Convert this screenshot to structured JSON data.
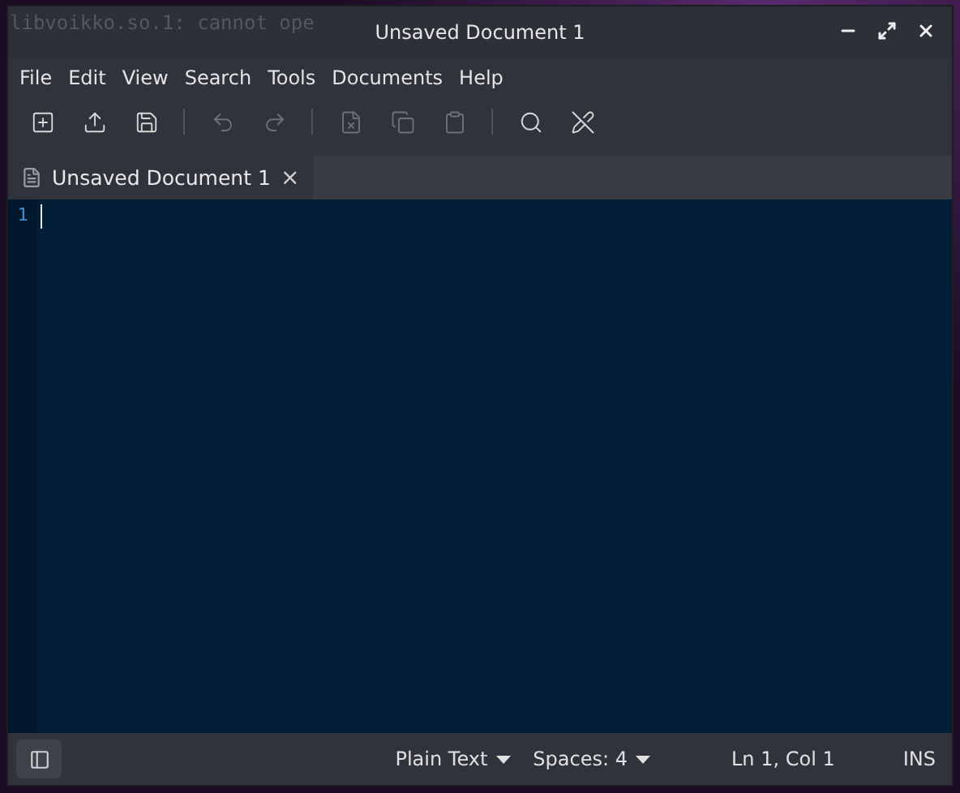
{
  "desktop_text": "libvoikko.so.1: cannot ope",
  "window": {
    "title": "Unsaved Document 1"
  },
  "menu": [
    "File",
    "Edit",
    "View",
    "Search",
    "Tools",
    "Documents",
    "Help"
  ],
  "toolbar": [
    {
      "kind": "button",
      "disabled": false
    },
    {
      "kind": "button",
      "disabled": false
    },
    {
      "kind": "button",
      "disabled": false
    },
    {
      "kind": "separator"
    },
    {
      "kind": "button",
      "disabled": true
    },
    {
      "kind": "button",
      "disabled": true
    },
    {
      "kind": "separator"
    },
    {
      "kind": "button",
      "disabled": true
    },
    {
      "kind": "button",
      "disabled": true
    },
    {
      "kind": "button",
      "disabled": true
    },
    {
      "kind": "separator"
    },
    {
      "kind": "button",
      "disabled": false
    },
    {
      "kind": "button",
      "disabled": false
    }
  ],
  "tabs": [
    {
      "label": "Unsaved Document 1",
      "selected": true,
      "close": "×"
    }
  ],
  "editor": {
    "line_numbers": [
      "1"
    ]
  },
  "status_bar": {
    "language": "Plain Text",
    "indent": "Spaces: 4",
    "position": "Ln 1, Col 1",
    "mode": "INS"
  }
}
